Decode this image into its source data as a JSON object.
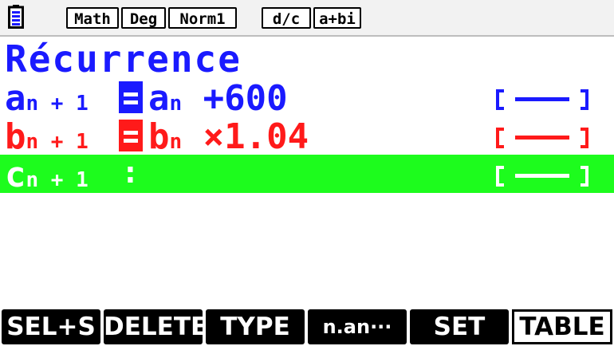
{
  "status_bar": {
    "battery_icon": "battery-icon",
    "badges": [
      "Math",
      "Deg",
      "Norm1",
      "d/c",
      "a+bi"
    ]
  },
  "title": "Récurrence",
  "sequences": [
    {
      "name_base": "a",
      "name_sub": "n + 1",
      "expr_base": "a",
      "expr_sub": "n",
      "expr_rest": " +600",
      "color": "#1a1aff",
      "selected": false
    },
    {
      "name_base": "b",
      "name_sub": "n + 1",
      "expr_base": "b",
      "expr_sub": "n",
      "expr_rest": " ×1.04",
      "color": "#ff1a1a",
      "selected": false
    },
    {
      "name_base": "c",
      "name_sub": "n + 1",
      "colon": ":",
      "color": "#ffffff",
      "selected": true,
      "highlight_color": "#1dfc1d"
    }
  ],
  "function_keys": [
    "SEL+S",
    "DELETE",
    "TYPE",
    "n.an···",
    "SET",
    "TABLE"
  ]
}
